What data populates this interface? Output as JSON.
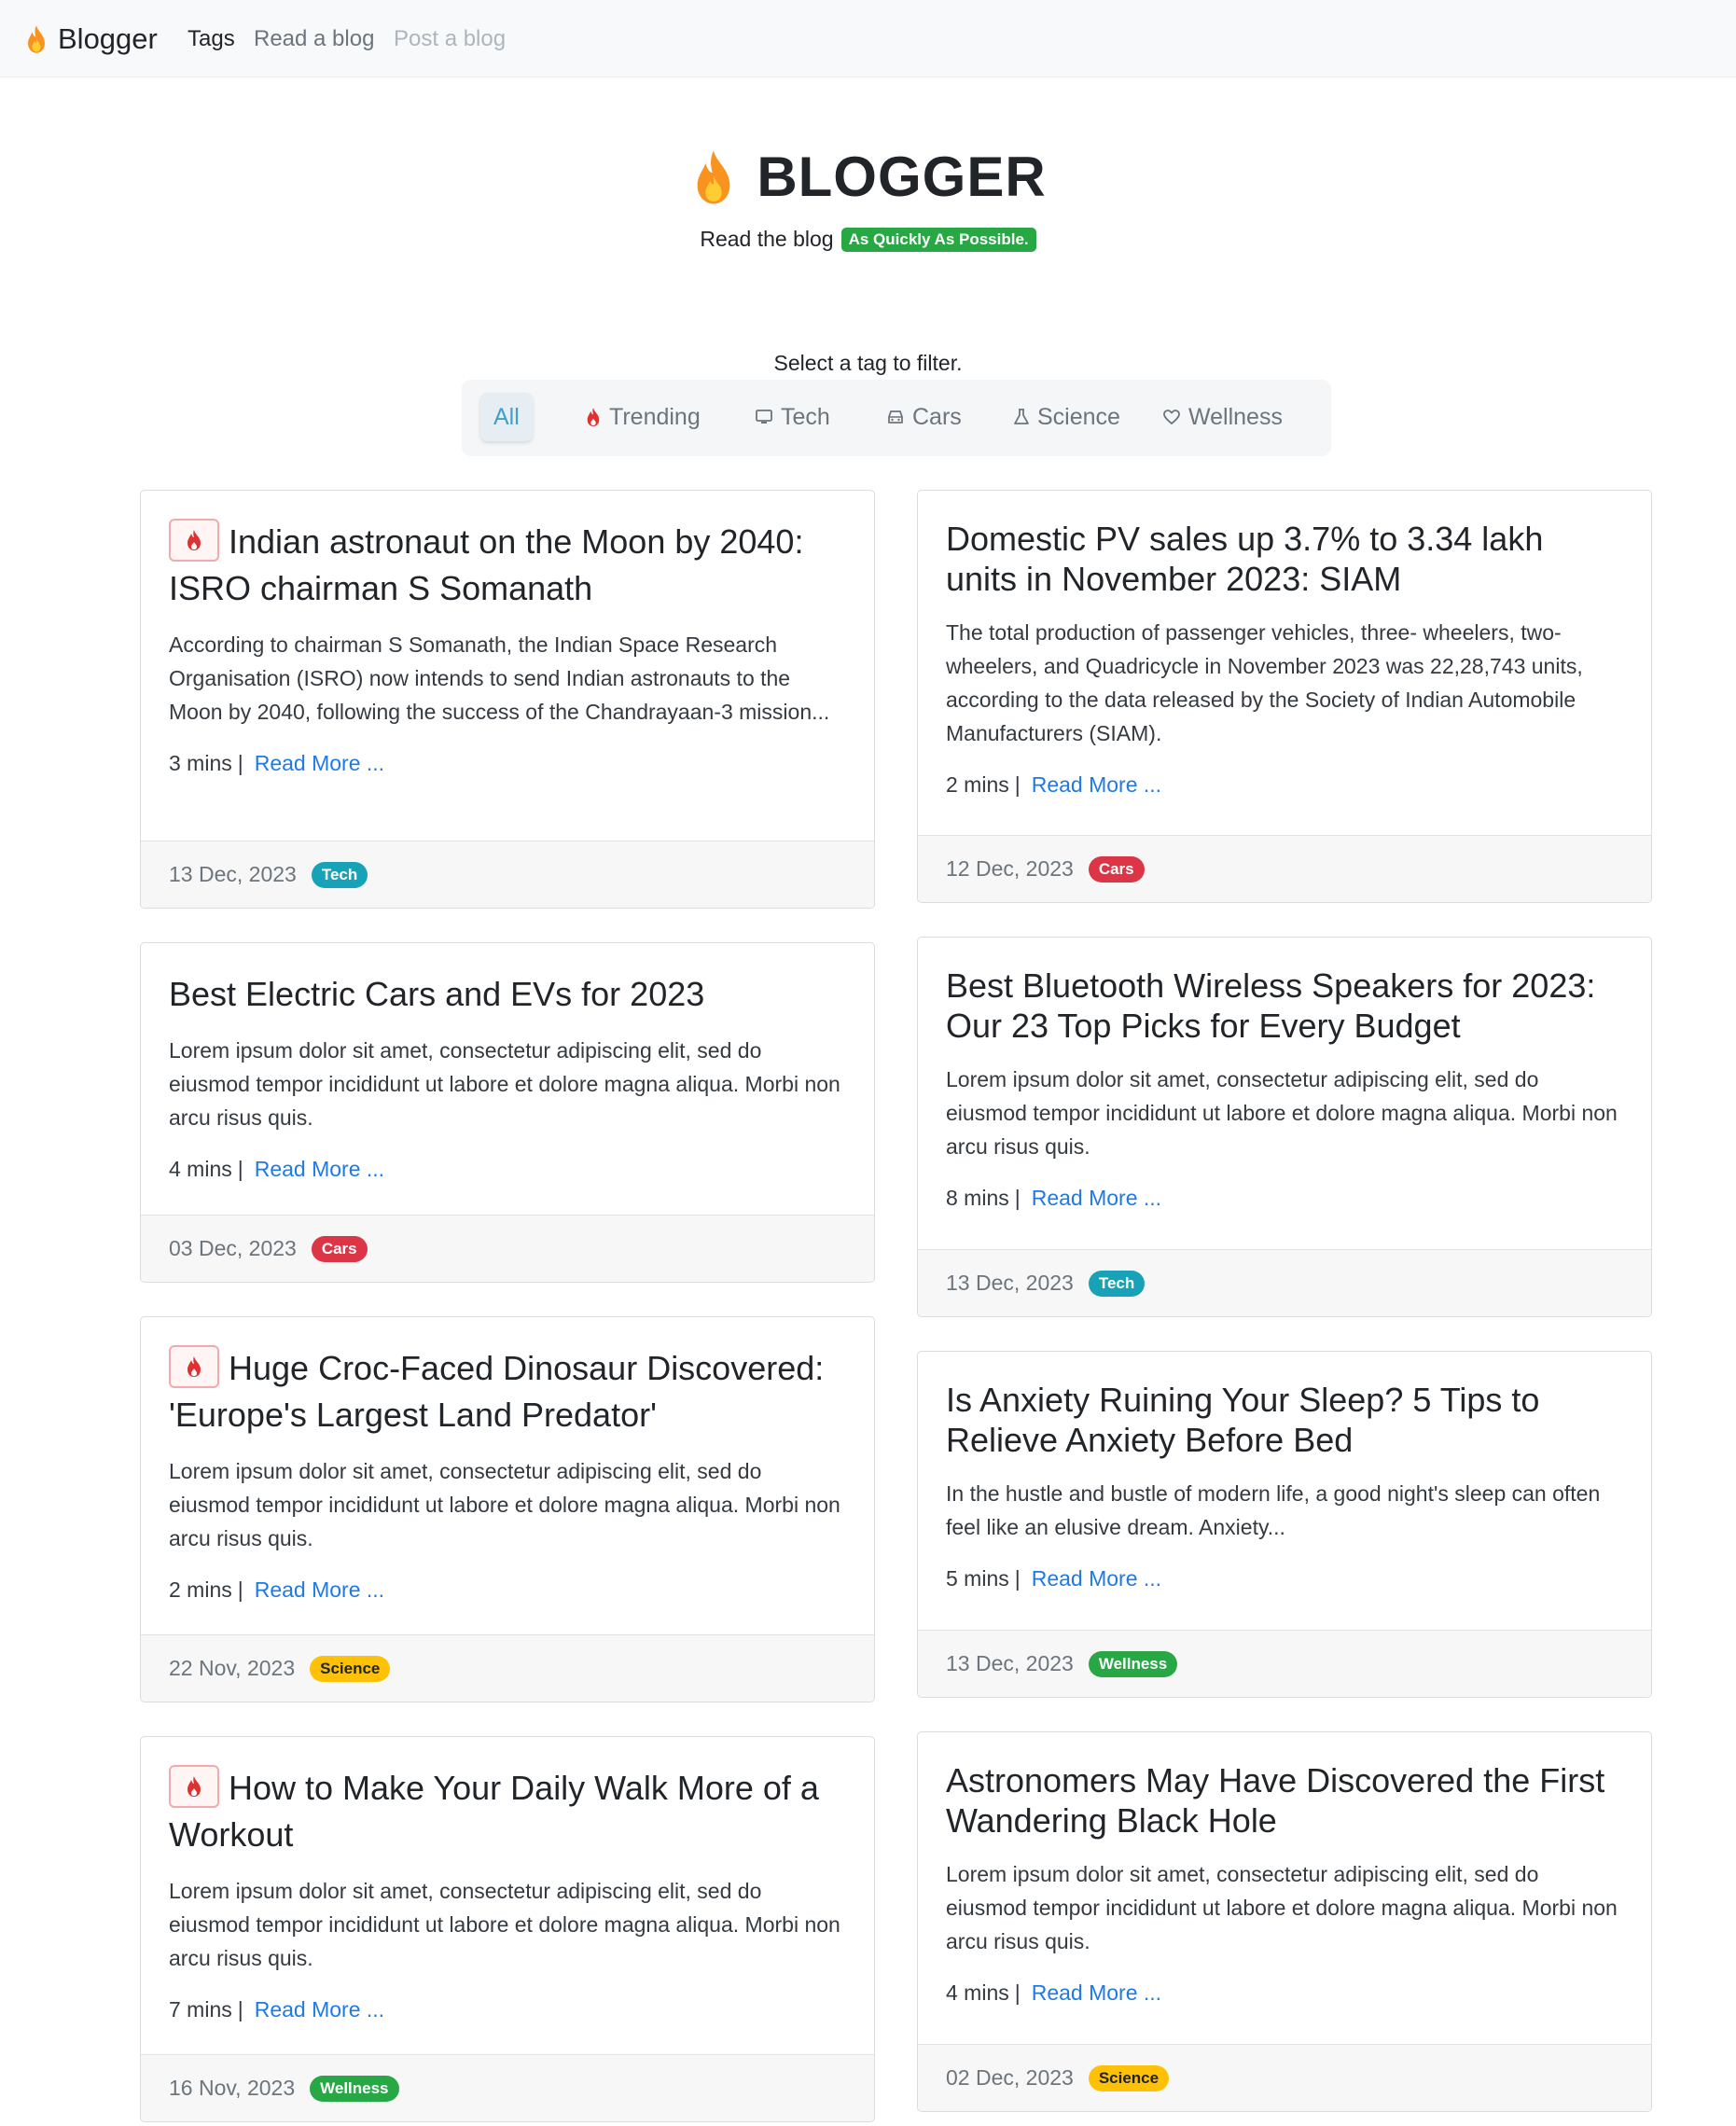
{
  "colors": {
    "tech": "#17a2b8",
    "cars": "#dc3545",
    "science": "#ffc107",
    "wellness": "#28a745",
    "link": "#1f7ae6"
  },
  "navbar": {
    "brand": "Blogger",
    "brand_icon": "flame-icon",
    "links": [
      "Tags",
      "Read a blog",
      "Post a blog"
    ]
  },
  "hero": {
    "title": "BLOGGER",
    "subtitle": "Read the blog",
    "badge": "As Quickly As Possible."
  },
  "filter": {
    "label": "Select a tag to filter.",
    "chips": [
      {
        "label": "All",
        "icon": ""
      },
      {
        "label": "Trending",
        "icon": "fire-icon"
      },
      {
        "label": "Tech",
        "icon": "monitor-icon"
      },
      {
        "label": "Cars",
        "icon": "car-icon"
      },
      {
        "label": "Science",
        "icon": "flask-icon"
      },
      {
        "label": "Wellness",
        "icon": "heart-icon"
      }
    ]
  },
  "read_more_label": "Read More ...",
  "posts": [
    {
      "title": "Indian astronaut on the Moon by 2040: ISRO chairman S Somanath",
      "trending": true,
      "excerpt": "According to chairman S Somanath, the Indian Space Research Organisation (ISRO) now intends to send Indian astronauts to the Moon by 2040, following the success of the Chandrayaan-3 mission...",
      "read_time": "3 mins",
      "date": "13 Dec, 2023",
      "tag": "Tech"
    },
    {
      "title": "Domestic PV sales up 3.7% to 3.34 lakh units in November 2023: SIAM",
      "trending": false,
      "excerpt": "The total production of passenger vehicles, three- wheelers, two-wheelers, and Quadricycle in November 2023 was 22,28,743 units, according to the data released by the Society of Indian Automobile Manufacturers (SIAM).",
      "read_time": "2 mins",
      "date": "12 Dec, 2023",
      "tag": "Cars"
    },
    {
      "title": "Best Electric Cars and EVs for 2023",
      "trending": false,
      "excerpt": "Lorem ipsum dolor sit amet, consectetur adipiscing elit, sed do eiusmod tempor incididunt ut labore et dolore magna aliqua. Morbi non arcu risus quis.",
      "read_time": "4 mins",
      "date": "03 Dec, 2023",
      "tag": "Cars"
    },
    {
      "title": "Best Bluetooth Wireless Speakers for 2023: Our 23 Top Picks for Every Budget",
      "trending": false,
      "excerpt": "Lorem ipsum dolor sit amet, consectetur adipiscing elit, sed do eiusmod tempor incididunt ut labore et dolore magna aliqua. Morbi non arcu risus quis.",
      "read_time": "8 mins",
      "date": "13 Dec, 2023",
      "tag": "Tech"
    },
    {
      "title": "Huge Croc-Faced Dinosaur Discovered: 'Europe's Largest Land Predator'",
      "trending": true,
      "excerpt": "Lorem ipsum dolor sit amet, consectetur adipiscing elit, sed do eiusmod tempor incididunt ut labore et dolore magna aliqua. Morbi non arcu risus quis.",
      "read_time": "2 mins",
      "date": "22 Nov, 2023",
      "tag": "Science"
    },
    {
      "title": "Is Anxiety Ruining Your Sleep? 5 Tips to Relieve Anxiety Before Bed",
      "trending": false,
      "excerpt": "In the hustle and bustle of modern life, a good night's sleep can often feel like an elusive dream. Anxiety...",
      "read_time": "5 mins",
      "date": "13 Dec, 2023",
      "tag": "Wellness"
    },
    {
      "title": "How to Make Your Daily Walk More of a Workout",
      "trending": true,
      "excerpt": "Lorem ipsum dolor sit amet, consectetur adipiscing elit, sed do eiusmod tempor incididunt ut labore et dolore magna aliqua. Morbi non arcu risus quis.",
      "read_time": "7 mins",
      "date": "16 Nov, 2023",
      "tag": "Wellness"
    },
    {
      "title": "Astronomers May Have Discovered the First Wandering Black Hole",
      "trending": false,
      "excerpt": "Lorem ipsum dolor sit amet, consectetur adipiscing elit, sed do eiusmod tempor incididunt ut labore et dolore magna aliqua. Morbi non arcu risus quis.",
      "read_time": "4 mins",
      "date": "02 Dec, 2023",
      "tag": "Science"
    }
  ]
}
